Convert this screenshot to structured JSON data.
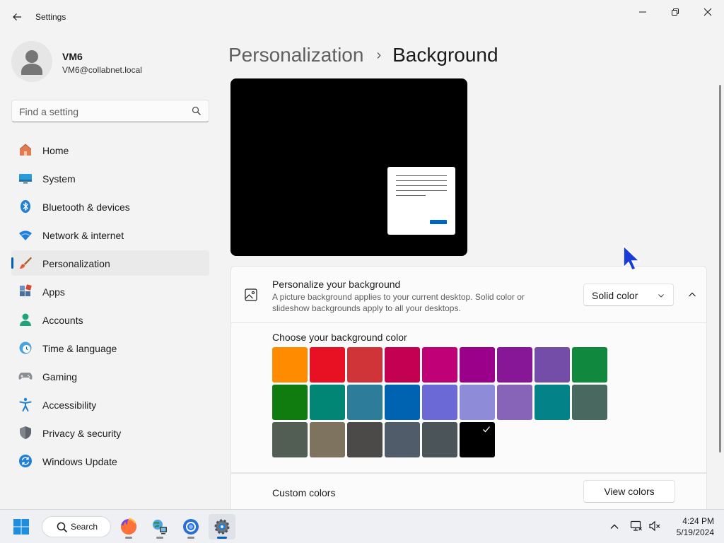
{
  "window": {
    "title": "Settings"
  },
  "user": {
    "name": "VM6",
    "email": "VM6@collabnet.local"
  },
  "search": {
    "placeholder": "Find a setting"
  },
  "sidebar": {
    "items": [
      {
        "label": "Home",
        "icon": "home-icon",
        "active": false
      },
      {
        "label": "System",
        "icon": "display-icon",
        "active": false
      },
      {
        "label": "Bluetooth & devices",
        "icon": "bluetooth-icon",
        "active": false
      },
      {
        "label": "Network & internet",
        "icon": "wifi-icon",
        "active": false
      },
      {
        "label": "Personalization",
        "icon": "paint-brush-icon",
        "active": true
      },
      {
        "label": "Apps",
        "icon": "apps-icon",
        "active": false
      },
      {
        "label": "Accounts",
        "icon": "person-icon",
        "active": false
      },
      {
        "label": "Time & language",
        "icon": "clock-globe-icon",
        "active": false
      },
      {
        "label": "Gaming",
        "icon": "gamepad-icon",
        "active": false
      },
      {
        "label": "Accessibility",
        "icon": "accessibility-icon",
        "active": false
      },
      {
        "label": "Privacy & security",
        "icon": "shield-icon",
        "active": false
      },
      {
        "label": "Windows Update",
        "icon": "update-icon",
        "active": false
      }
    ]
  },
  "header": {
    "parent": "Personalization",
    "separator": "›",
    "current": "Background"
  },
  "background_setting": {
    "title": "Personalize your background",
    "description": "A picture background applies to your current desktop. Solid color or slideshow backgrounds apply to all your desktops.",
    "dropdown_value": "Solid color"
  },
  "color_picker": {
    "title": "Choose your background color",
    "colors": [
      "#FF8C00",
      "#E81123",
      "#D13438",
      "#C30052",
      "#BF0077",
      "#9A0089",
      "#881798",
      "#744DA9",
      "#10893E",
      "#107C10",
      "#018574",
      "#2D7D9A",
      "#0063B1",
      "#6B69D6",
      "#8E8CD8",
      "#8764B8",
      "#038387",
      "#486860",
      "#525E54",
      "#7E735F",
      "#4C4A48",
      "#515C6B",
      "#4A5459",
      "#000000"
    ],
    "selected_index": 23
  },
  "custom_colors": {
    "label": "Custom colors",
    "button_label": "View colors"
  },
  "colors": {
    "accent": "#005fb8",
    "preview_background": "#000000"
  },
  "taskbar": {
    "search_label": "Search",
    "apps": [
      {
        "name": "firefox-icon",
        "active": false
      },
      {
        "name": "network-globe-icon",
        "active": false
      },
      {
        "name": "chrome-icon",
        "active": false
      },
      {
        "name": "settings-gear-icon",
        "active": true
      }
    ],
    "time": "4:24 PM",
    "date": "5/19/2024"
  }
}
